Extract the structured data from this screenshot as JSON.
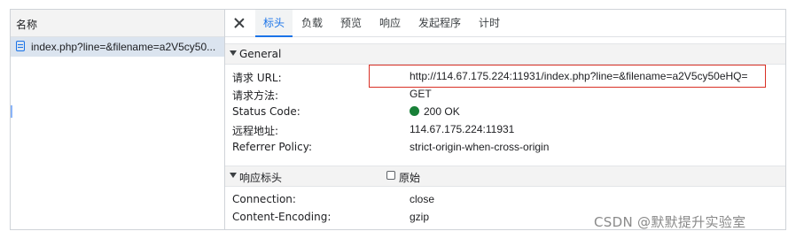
{
  "name_panel": {
    "header": "名称",
    "request_name": "index.php?line=&filename=a2V5cy50..."
  },
  "tabs": [
    "标头",
    "负载",
    "预览",
    "响应",
    "发起程序",
    "计时"
  ],
  "general": {
    "title": "General",
    "rows": [
      {
        "label": "请求 URL:",
        "value": "http://114.67.175.224:11931/index.php?line=&filename=a2V5cy50eHQ="
      },
      {
        "label": "请求方法:",
        "value": "GET"
      },
      {
        "label": "Status Code:",
        "value": "200 OK"
      },
      {
        "label": "远程地址:",
        "value": "114.67.175.224:11931"
      },
      {
        "label": "Referrer Policy:",
        "value": "strict-origin-when-cross-origin"
      }
    ]
  },
  "response_headers": {
    "title": "响应标头",
    "raw_label": "原始",
    "raw_checked": false,
    "rows": [
      {
        "label": "Connection:",
        "value": "close"
      },
      {
        "label": "Content-Encoding:",
        "value": "gzip"
      }
    ]
  },
  "status_color": "#188038",
  "accent_color": "#1a73e8",
  "highlight_color": "#d93025",
  "watermark": "CSDN @默默提升实验室"
}
